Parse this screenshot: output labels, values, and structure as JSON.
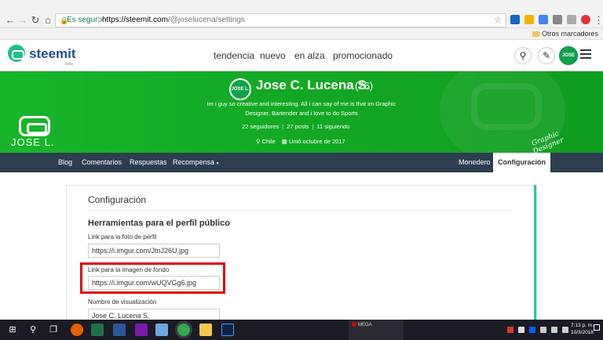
{
  "browser": {
    "secure_label": "Es seguro",
    "url_host": "https://steemit.com",
    "url_path": "/@joselucena/settings",
    "bookmarks_other": "Otros marcadores",
    "bookmarks_chevron": "»"
  },
  "site": {
    "logo_text": "steemit",
    "logo_sub": "beta",
    "nav": [
      "tendencia",
      "nuevo",
      "en alza",
      "promocionado"
    ],
    "avatar_text": "JOSE L."
  },
  "banner": {
    "brand_text": "JOSE L.",
    "script_line1": "Graphic",
    "script_line2": "Designer"
  },
  "profile": {
    "avatar_text": "JOSE L.",
    "name": "Jose C. Lucena S.",
    "reputation": "(26)",
    "about": "Im i guy so creative and interesting. All i can say of me is that im Graphic Designer, Bartender and i love to do Sports",
    "followers": "22 seguidores",
    "posts": "27 posts",
    "following": "11 siguiendo",
    "location": "Chile",
    "joined": "Unió octubre de 2017"
  },
  "subnav": {
    "left": [
      "Blog",
      "Comentarios",
      "Respuestas",
      "Recompensa"
    ],
    "wallet": "Monedero",
    "settings": "Configuración"
  },
  "settings": {
    "title": "Configuración",
    "section": "Herramientas para el perfil público",
    "profile_pic_label": "Link para la foto de perfil",
    "profile_pic_value": "https://i.imgur.com/JtnJ26U.jpg",
    "cover_label": "Link para la imagen de fondo",
    "cover_value": "https://i.imgur.com/wUQVGg6.jpg",
    "display_name_label": "Nombre de visualización",
    "display_name_value": "Jose C. Lucena S."
  },
  "taskbar": {
    "preview_title": "MEGA",
    "time": "7:13 p. m.",
    "date": "10/3/2018"
  },
  "colors": {
    "steemit_blue": "#1a5099",
    "banner_green": "#13a824",
    "subnav_bg": "#2c3e4f",
    "highlight_red": "#e00000"
  }
}
